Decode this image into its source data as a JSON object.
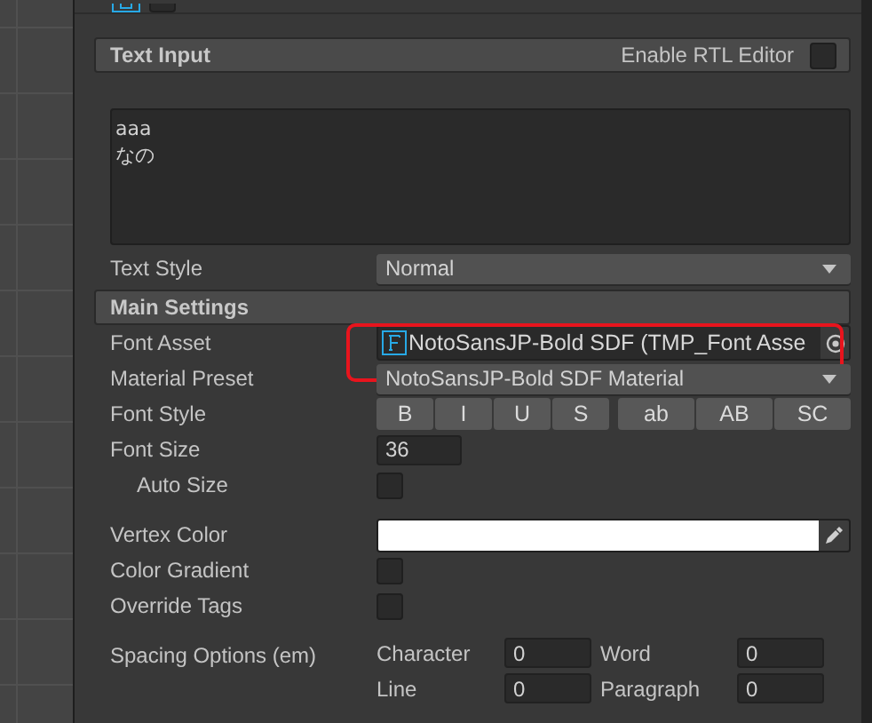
{
  "component": {
    "enabled": false
  },
  "text_input": {
    "title": "Text Input",
    "rtl_editor": {
      "label": "Enable RTL Editor",
      "checked": false
    },
    "value": "aaa\nなの"
  },
  "text_style": {
    "label": "Text Style",
    "value": "Normal"
  },
  "main_settings": {
    "title": "Main Settings",
    "groups": [
      [
        {
          "kind": "object",
          "label": "Font Asset",
          "value": "NotoSansJP-Bold SDF (TMP_Font Asse",
          "highlighted": true
        },
        {
          "kind": "dropdown",
          "label": "Material Preset",
          "value": "NotoSansJP-Bold SDF Material"
        },
        {
          "kind": "styles",
          "label": "Font Style",
          "button_groups": [
            [
              {
                "label": "B",
                "selected": false
              },
              {
                "label": "I",
                "selected": false
              },
              {
                "label": "U",
                "selected": false
              },
              {
                "label": "S",
                "selected": false
              }
            ],
            [
              {
                "label": "ab",
                "selected": false
              },
              {
                "label": "AB",
                "selected": false
              },
              {
                "label": "SC",
                "selected": false
              }
            ]
          ]
        },
        {
          "kind": "number",
          "label": "Font Size",
          "value": "36"
        },
        {
          "kind": "checkbox",
          "label": "Auto Size",
          "checked": false,
          "indented": true
        }
      ],
      [
        {
          "kind": "color",
          "label": "Vertex Color",
          "color": "#ffffff"
        },
        {
          "kind": "checkbox",
          "label": "Color Gradient",
          "checked": false,
          "indented": false
        },
        {
          "kind": "checkbox",
          "label": "Override Tags",
          "checked": false,
          "indented": false
        }
      ],
      [
        {
          "kind": "spacing",
          "label": "Spacing Options (em)",
          "fields": [
            {
              "label": "Character",
              "value": "0"
            },
            {
              "label": "Word",
              "value": "0"
            },
            {
              "label": "Line",
              "value": "0"
            },
            {
              "label": "Paragraph",
              "value": "0"
            }
          ]
        }
      ]
    ]
  }
}
